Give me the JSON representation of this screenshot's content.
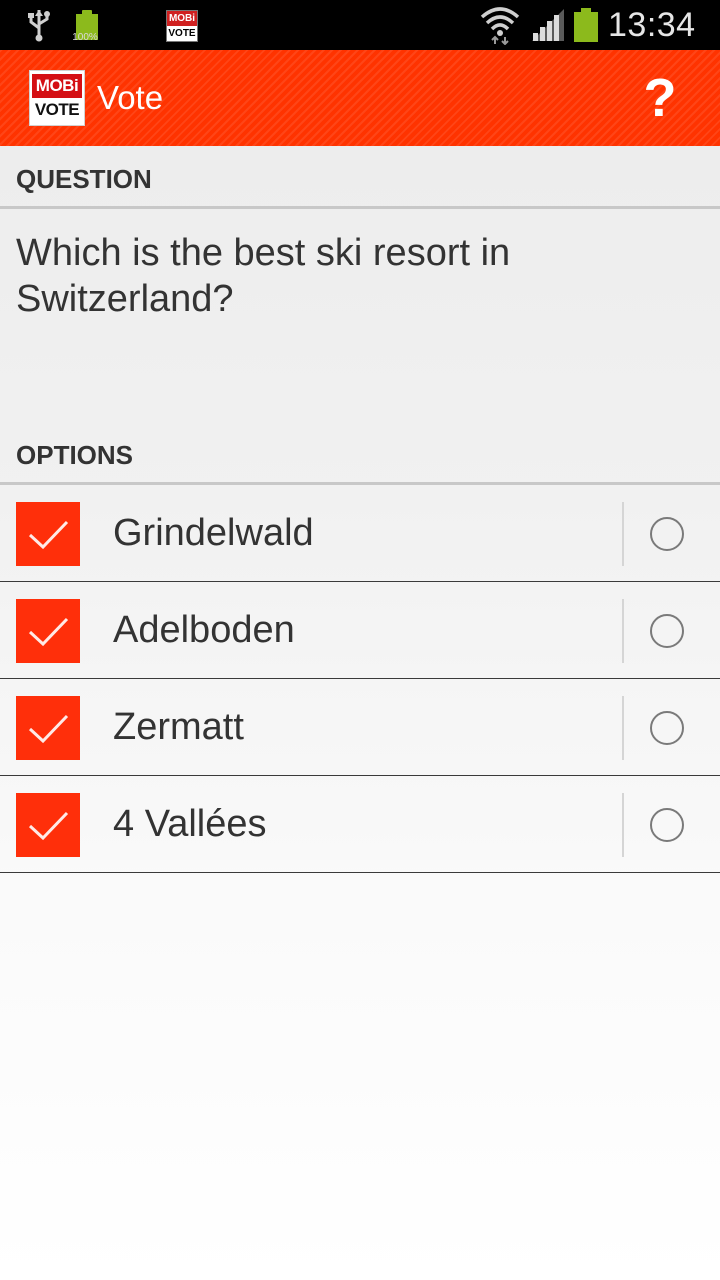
{
  "status_bar": {
    "battery_small_label": "100%",
    "notif_logo_top": "MOBi",
    "notif_logo_bottom": "VOTE",
    "time": "13:34",
    "icons": [
      "usb-icon",
      "battery-icon",
      "mobivote-notification-icon",
      "wifi-icon",
      "signal-icon",
      "battery-icon"
    ]
  },
  "action_bar": {
    "logo_top": "MOBi",
    "logo_bottom": "VOTE",
    "title": "Vote",
    "help_label": "?",
    "color": "#ff3300"
  },
  "question": {
    "header": "QUESTION",
    "text": "Which is the best ski resort in Switzerland?"
  },
  "options": {
    "header": "OPTIONS",
    "items": [
      {
        "label": "Grindelwald",
        "checked": true,
        "selected": false
      },
      {
        "label": "Adelboden",
        "checked": true,
        "selected": false
      },
      {
        "label": "Zermatt",
        "checked": true,
        "selected": false
      },
      {
        "label": "4 Vallées",
        "checked": true,
        "selected": false
      }
    ],
    "check_color": "#ff2f0a"
  }
}
